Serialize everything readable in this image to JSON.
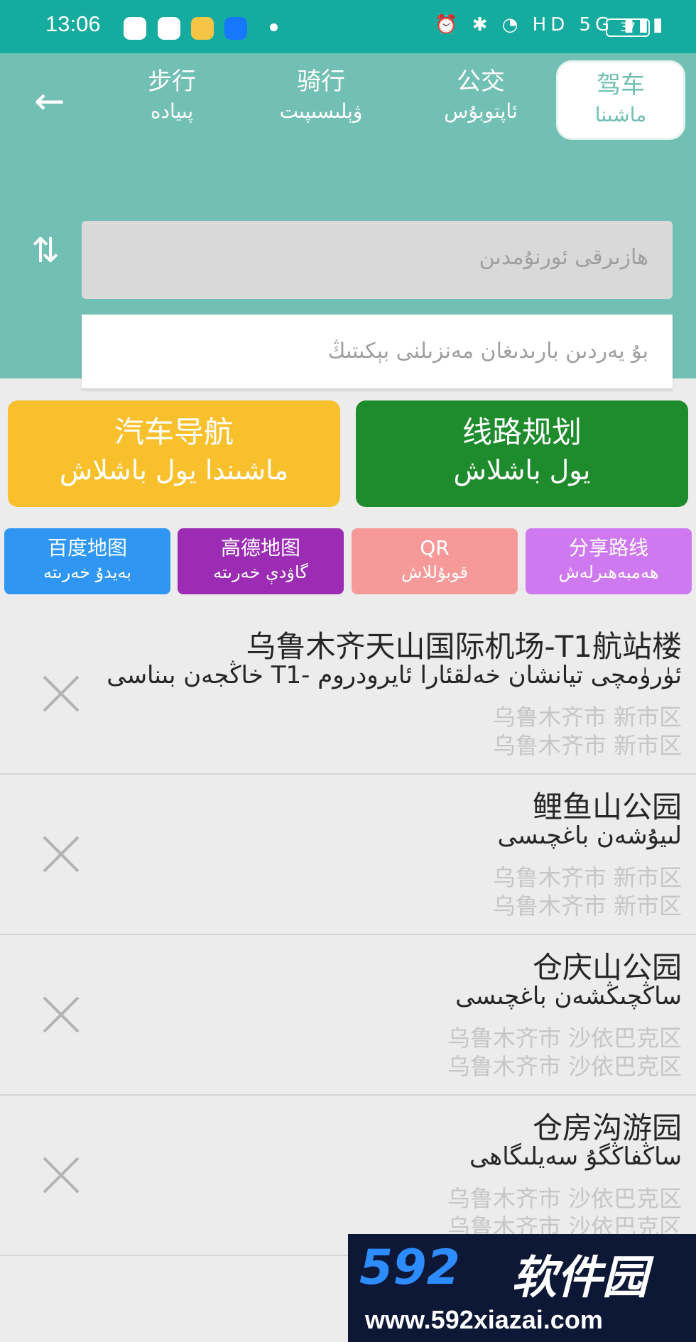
{
  "status": {
    "time": "13:06",
    "icons": "⏰ ✱ ◔ HD 5G ▮▮▮",
    "battery": "37"
  },
  "tabs": [
    {
      "cn": "步行",
      "ug": "پىيادە"
    },
    {
      "cn": "骑行",
      "ug": "ۋېلىسىپىت"
    },
    {
      "cn": "公交",
      "ug": "ئاپتوبۇس"
    },
    {
      "cn": "驾车",
      "ug": "ماشىنا"
    }
  ],
  "route": {
    "from_placeholder": "ھازىرقى ئورنۇمدىن",
    "to_placeholder": "بۇ يەردىن بارىدىغان مەنزىلنى بېكىتىڭ"
  },
  "actions": {
    "car_nav": {
      "cn": "汽车导航",
      "ug": "ماشىندا يول باشلاش"
    },
    "route_plan": {
      "cn": "线路规划",
      "ug": "يول باشلاش"
    }
  },
  "maps": [
    {
      "cn": "百度地图",
      "ug": "بەيدۇ خەرىتە"
    },
    {
      "cn": "高德地图",
      "ug": "گاۋدې خەرىتە"
    },
    {
      "cn": "QR",
      "ug": "قوبۇللاش"
    },
    {
      "cn": "分享路线",
      "ug": "ھەمبەھىرلەش"
    }
  ],
  "history": [
    {
      "cn": "乌鲁木齐天山国际机场-T1航站楼",
      "ug": "ئۈرۈمچى تيانشان خەلقئارا ئايرودروم -T1 خاڭجەن بىناسى",
      "city1": "乌鲁木齐市 新市区",
      "city2": "乌鲁木齐市 新市区"
    },
    {
      "cn": "鲤鱼山公园",
      "ug": "لىيۇشەن باغچىسى",
      "city1": "乌鲁木齐市 新市区",
      "city2": "乌鲁木齐市 新市区"
    },
    {
      "cn": "仓庆山公园",
      "ug": "ساڭچىڭشەن باغچىسى",
      "city1": "乌鲁木齐市 沙依巴克区",
      "city2": "乌鲁木齐市 沙依巴克区"
    },
    {
      "cn": "仓房沟游园",
      "ug": "ساڭفاڭگۇ سەيلىگاھى",
      "city1": "乌鲁木齐市 沙依巴克区",
      "city2": "乌鲁木齐市 沙依巴克区"
    }
  ],
  "watermark": {
    "logo": "592",
    "name": "软件园",
    "url": "www.592xiazai.com"
  },
  "colors": {
    "statusbar": "#16ab9f",
    "header": "#72bfb3",
    "car_nav": "#f9c02e",
    "route_plan": "#1e8b2c",
    "baidu": "#2f97f3",
    "gaode": "#9b2cb3",
    "qr": "#f59a98",
    "share": "#cf79f0"
  }
}
